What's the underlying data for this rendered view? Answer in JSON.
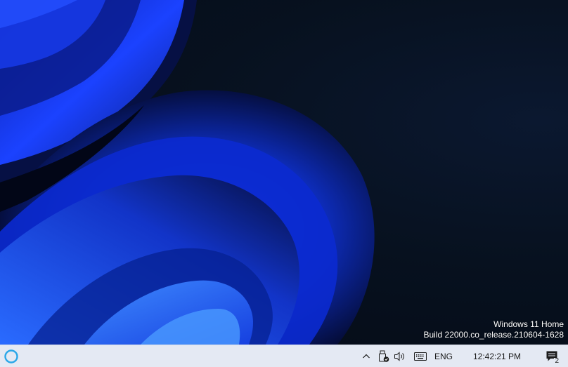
{
  "desktop": {
    "watermark": {
      "edition": "Windows 11 Home",
      "build": "Build 22000.co_release.210604-1628"
    }
  },
  "taskbar": {
    "cortana_icon": "cortana-ring-icon",
    "tray": {
      "chevron_icon": "chevron-up-icon",
      "usb_icon": "usb-safely-remove-icon",
      "volume_icon": "speaker-volume-icon",
      "keyboard_icon": "touch-keyboard-icon",
      "language": "ENG",
      "clock": "12:42:21 PM",
      "notification_icon": "action-center-icon",
      "notification_count": "2"
    }
  },
  "colors": {
    "taskbar_bg": "#e4e9f3",
    "cortana_ring": "#2aa7e8",
    "wallpaper_blue": "#1e4cff"
  }
}
